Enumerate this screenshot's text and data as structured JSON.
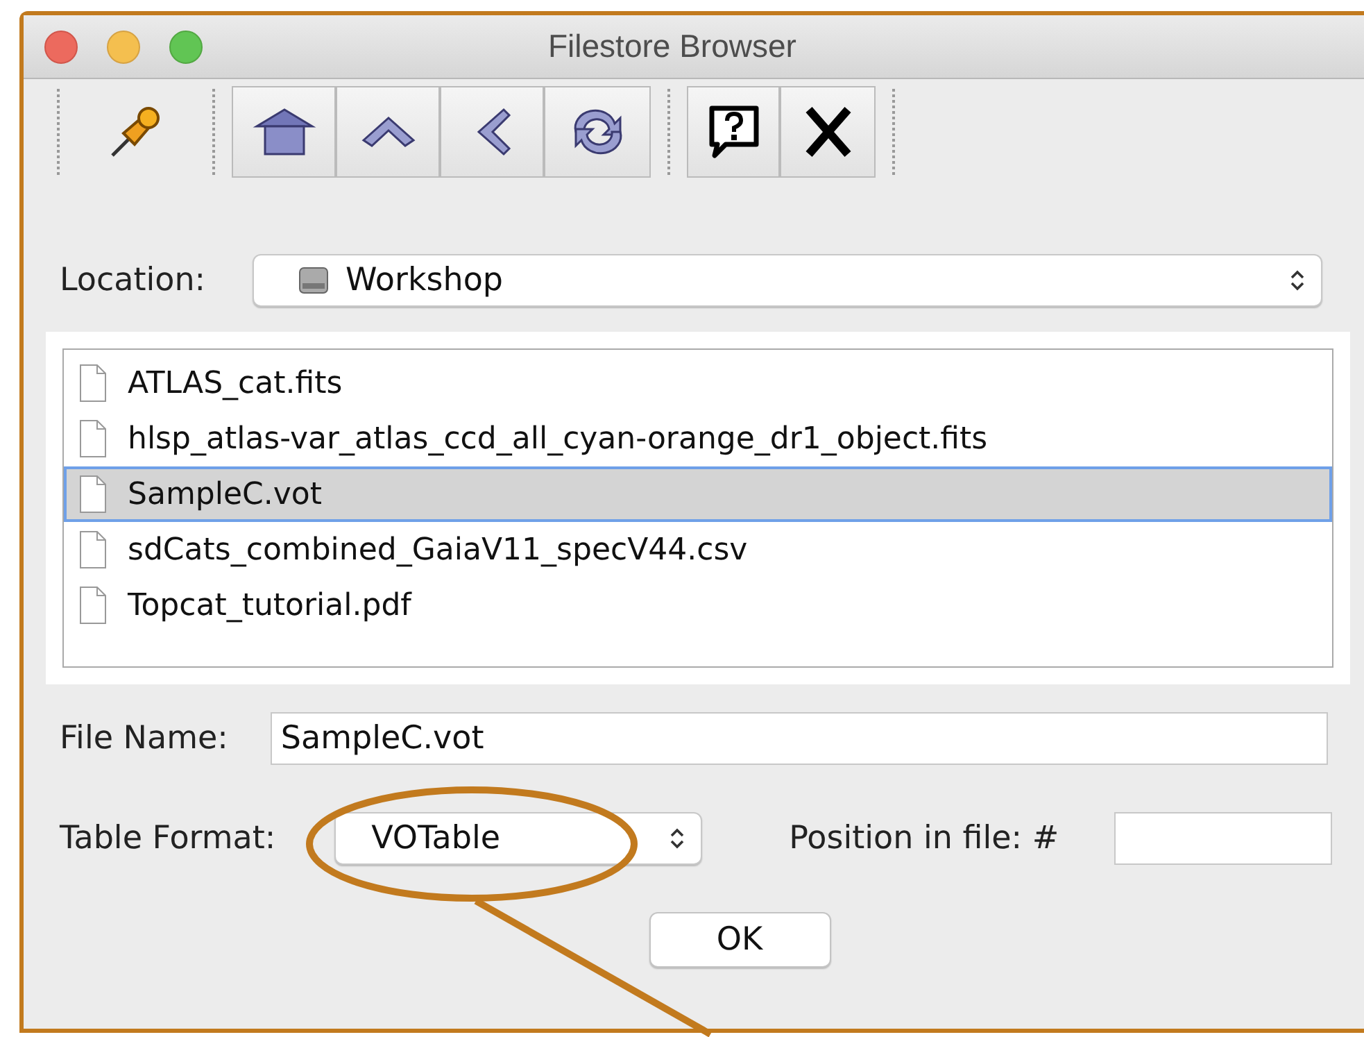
{
  "window": {
    "title": "Filestore Browser"
  },
  "location": {
    "label": "Location:",
    "value": "Workshop"
  },
  "files": [
    {
      "name": "ATLAS_cat.fits",
      "selected": false
    },
    {
      "name": "hlsp_atlas-var_atlas_ccd_all_cyan-orange_dr1_object.fits",
      "selected": false
    },
    {
      "name": "SampleC.vot",
      "selected": true
    },
    {
      "name": "sdCats_combined_GaiaV11_specV44.csv",
      "selected": false
    },
    {
      "name": "Topcat_tutorial.pdf",
      "selected": false
    }
  ],
  "file_name": {
    "label": "File Name:",
    "value": "SampleC.vot"
  },
  "table_format": {
    "label": "Table Format:",
    "value": "VOTable"
  },
  "position": {
    "label": "Position in file: #"
  },
  "ok_button": "OK"
}
